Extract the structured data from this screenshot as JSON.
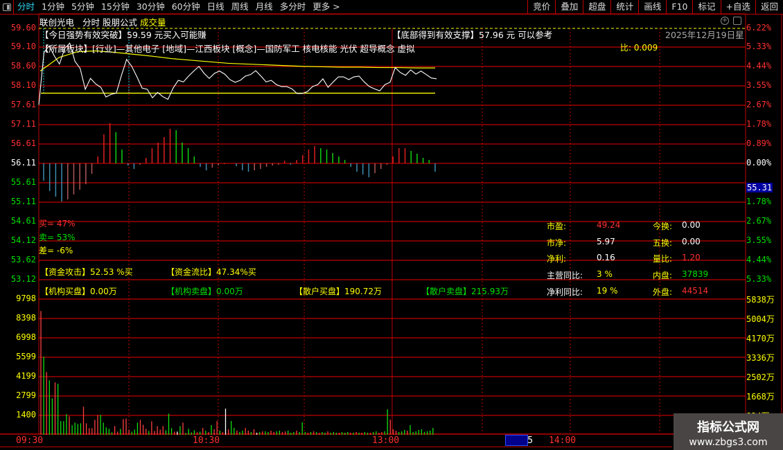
{
  "toolbar": {
    "tabs": [
      "分时",
      "1分钟",
      "5分钟",
      "15分钟",
      "30分钟",
      "60分钟",
      "日线",
      "周线",
      "月线",
      "多分时",
      "更多 >"
    ],
    "right": [
      "竞价",
      "叠加",
      "超盘",
      "统计",
      "画线",
      "F10",
      "标记",
      "+自选",
      "返回"
    ]
  },
  "header": {
    "stock": "联创光电",
    "period": "分时",
    "formula": "股朋公式",
    "indicator": "成交量"
  },
  "signals": {
    "breakout": "【今日强势有效突破】59.59 元买入可能赚",
    "support": "【底部得到有效支撑】57.96 元 可以参考",
    "date": "2025年12月19日星期",
    "sector": "【所属板块】[行业]—其他电子 [地域]—江西板块 [概念]—国防军工 核电核能 光伏 超导概念 虚拟",
    "ratio_tail": "比: 0.009"
  },
  "price_axis": [
    "59.60",
    "59.10",
    "58.60",
    "58.10",
    "57.61",
    "57.11",
    "56.61",
    "56.11",
    "55.61",
    "55.11",
    "54.61",
    "54.12",
    "53.62",
    "53.12"
  ],
  "pct_axis": [
    "6.22%",
    "5.33%",
    "4.44%",
    "3.55%",
    "2.67%",
    "1.78%",
    "0.89%",
    "0.00%",
    "55.31",
    "1.78%",
    "2.67%",
    "3.55%",
    "4.44%",
    "5.33%"
  ],
  "vol_axis": [
    "9798",
    "8398",
    "6998",
    "5599",
    "4199",
    "2799",
    "1400"
  ],
  "amt_axis": [
    "5838万",
    "5004万",
    "4170万",
    "3336万",
    "2502万",
    "1668万",
    "834万"
  ],
  "time_axis": [
    "09:30",
    "10:30",
    "13:00",
    "13:45",
    "14:00"
  ],
  "buy_sell": {
    "buy": "买= 47%",
    "sell": "卖= 53%",
    "diff": "差= -6%"
  },
  "funds": {
    "attack": "【资金攻击】52.53 %买",
    "flow": "【资金流比】47.34%买",
    "inst_buy": "【机构买盘】0.00万",
    "inst_sell": "【机构卖盘】0.00万",
    "retail_buy": "【散户买盘】190.72万",
    "retail_sell": "【散户卖盘】215.93万"
  },
  "stats": [
    {
      "l1": "市盈:",
      "v1": "49.24",
      "l2": "今换:",
      "v2": "0.00"
    },
    {
      "l1": "市净:",
      "v1": "5.97",
      "l2": "五换:",
      "v2": "0.00"
    },
    {
      "l1": "净利:",
      "v1": "0.16",
      "l2": "量比:",
      "v2": "1.20"
    },
    {
      "l1": "主营同比:",
      "v1": "3 %",
      "l2": "内盘:",
      "v2": "37839"
    },
    {
      "l1": "净利同比:",
      "v1": "19 %",
      "l2": "外盘:",
      "v2": "44514"
    }
  ],
  "watermark": {
    "name": "指标公式网",
    "url": "www.zbgs3.com"
  },
  "colors": {
    "grid": "#c00000",
    "up": "#ff3030",
    "down": "#00e000",
    "price_line": "#ffffff",
    "avg_line": "#ffff00"
  },
  "chart_data": {
    "type": "line",
    "price_range": [
      53.12,
      59.6
    ],
    "support_price": 57.93,
    "price": [
      57.63,
      58.98,
      59.15,
      58.89,
      58.68,
      59.08,
      59.22,
      58.75,
      58.57,
      58.03,
      58.31,
      58.17,
      58.08,
      57.83,
      57.9,
      57.93,
      58.39,
      58.8,
      58.62,
      58.35,
      58.06,
      58.03,
      57.81,
      57.95,
      57.84,
      57.77,
      58.06,
      58.26,
      58.22,
      58.37,
      58.5,
      58.62,
      58.44,
      58.31,
      58.44,
      58.5,
      58.42,
      58.28,
      58.21,
      58.26,
      58.37,
      58.41,
      58.51,
      58.37,
      58.22,
      58.26,
      58.15,
      58.1,
      58.1,
      58.04,
      57.92,
      57.92,
      57.97,
      58.1,
      58.15,
      58.3,
      58.08,
      58.22,
      58.35,
      58.35,
      58.28,
      58.35,
      58.37,
      58.22,
      58.1,
      58.04,
      57.99,
      58.15,
      58.21,
      58.59,
      58.46,
      58.39,
      58.53,
      58.42,
      58.5,
      58.41,
      58.32,
      58.3
    ],
    "avg": [
      58.5,
      58.85,
      59.0,
      59.02,
      58.98,
      58.93,
      58.88,
      58.82,
      58.78,
      58.74,
      58.7,
      58.68,
      58.66,
      58.64,
      58.62,
      58.61,
      58.6,
      58.6,
      58.59,
      58.59,
      58.58,
      58.58
    ],
    "macd": [
      -25,
      -40,
      -48,
      -55,
      -52,
      -45,
      -38,
      -30,
      -15,
      10,
      42,
      58,
      45,
      20,
      -3,
      -8,
      -2,
      8,
      22,
      30,
      38,
      50,
      48,
      30,
      22,
      10,
      -5,
      -10,
      -6,
      -3,
      -1,
      0,
      -4,
      -10,
      -12,
      -10,
      -8,
      -5,
      -3,
      -2,
      4,
      -2,
      5,
      12,
      20,
      25,
      22,
      20,
      15,
      10,
      5,
      -5,
      -12,
      -16,
      -20,
      -14,
      -8,
      -2,
      10,
      22,
      22,
      18,
      14,
      8,
      5,
      -12
    ],
    "volume": [
      8980,
      5670,
      4550,
      3950,
      2640,
      3800,
      3700,
      990,
      990,
      1490,
      1340,
      690,
      880,
      790,
      830,
      2040,
      830,
      480,
      480,
      1080,
      1440,
      1440,
      880,
      530,
      430,
      180,
      630,
      230,
      430,
      1130,
      1180,
      380,
      230,
      380,
      880,
      1080,
      730,
      430,
      280,
      980,
      280,
      630,
      380,
      630,
      330,
      1530,
      480,
      230,
      230,
      630,
      880,
      130,
      430,
      180,
      330,
      180,
      230,
      500,
      300,
      200,
      700,
      400,
      1000,
      300,
      200,
      1900,
      400,
      1000,
      500,
      300,
      200,
      300,
      500,
      300,
      200,
      400,
      150,
      200,
      250,
      250,
      200,
      300,
      200,
      250,
      300,
      200,
      250,
      300,
      150,
      200,
      300,
      200,
      900,
      200,
      150,
      200,
      250,
      200,
      150,
      200,
      150,
      250,
      150,
      200,
      150,
      150,
      200,
      150,
      200,
      150,
      150,
      200,
      150,
      150,
      200,
      150,
      150,
      200,
      250,
      150,
      200,
      250,
      1850,
      1100,
      400,
      300,
      200,
      250,
      350,
      300,
      700,
      200,
      250,
      350,
      400,
      200,
      250,
      300,
      500
    ],
    "volume_dir": "rgrggrggggrgggg rrrrrrgggggrrgrrrgggrrrgrrrrrgggrwgrggggrgrgrgrrgrwrggrggrrgrwgrggrrggrrgggrgggrgrgrggrgggrgggrgrgrggrggrrggrrrgggrggggggggg"
  }
}
